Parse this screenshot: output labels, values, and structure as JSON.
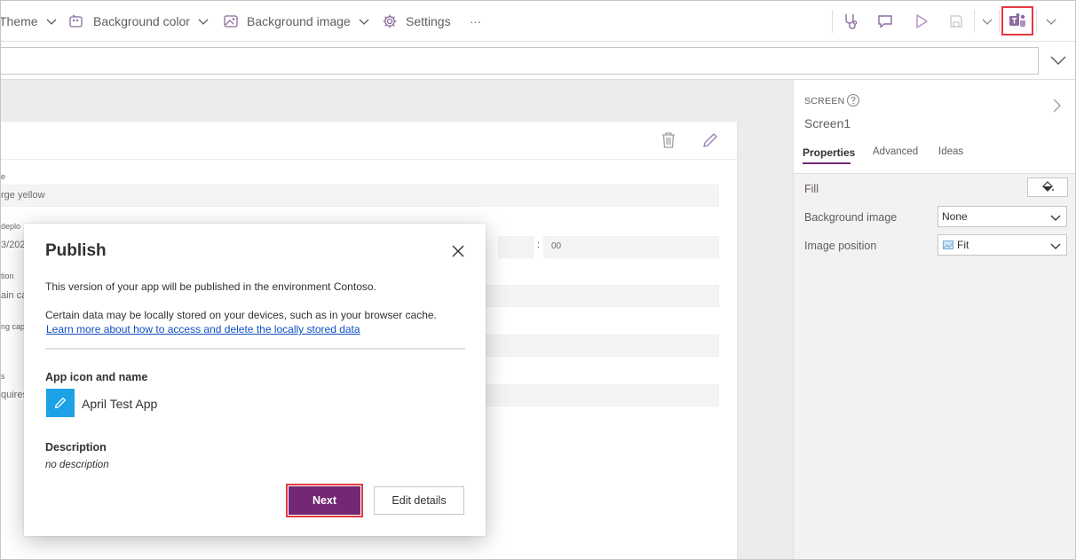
{
  "toolbar": {
    "theme_label": "Theme",
    "bg_color_label": "Background color",
    "bg_image_label": "Background image",
    "settings_label": "Settings",
    "more_label": "···"
  },
  "form": {
    "field1_label": "e",
    "field1_value": "rge yellow",
    "field2_label": "deplo",
    "field2_value": "3/202",
    "field2_sep": ":",
    "field2_minutes": "00",
    "field3_label": "tion",
    "field3_value": "ain ca",
    "field4_label": "ng cap",
    "field5_label": "s",
    "field5_value": "quires"
  },
  "panel": {
    "screen_caption": "SCREEN",
    "screen_name": "Screen1",
    "tabs": [
      "Properties",
      "Advanced",
      "Ideas"
    ],
    "fill_label": "Fill",
    "bg_image_label": "Background image",
    "bg_image_value": "None",
    "image_position_label": "Image position",
    "image_position_value": "Fit"
  },
  "dialog": {
    "title": "Publish",
    "env_text": "This version of your app will be published in the environment Contoso.",
    "storage_text": "Certain data may be locally stored on your devices, such as in your browser cache.",
    "link_text": "Learn more about how to access and delete the locally stored data",
    "app_section": "App icon and name",
    "app_name": "April Test App",
    "desc_section": "Description",
    "desc_value": "no description",
    "next_label": "Next",
    "edit_label": "Edit details"
  },
  "colors": {
    "accent": "#742774",
    "highlight": "#e23b41",
    "app_icon_bg": "#1da1e6",
    "link": "#0f4fc2"
  }
}
